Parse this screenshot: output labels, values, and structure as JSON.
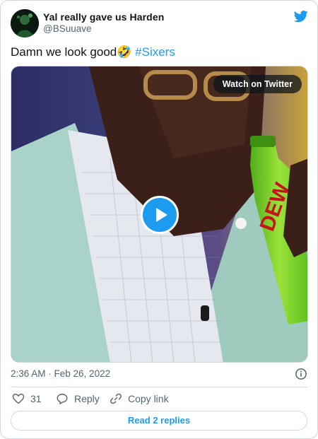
{
  "author": {
    "display_name": "Yal really gave us Harden",
    "handle": "@BSuuave",
    "avatar_icon": "avatar-image"
  },
  "tweet": {
    "text": "Damn we look good🤣",
    "hashtag": "#Sixers",
    "timestamp": "2:36 AM · Feb 26, 2022"
  },
  "media": {
    "watch_label": "Watch on Twitter",
    "play_icon": "play-icon"
  },
  "actions": {
    "like_count": "31",
    "reply_label": "Reply",
    "copy_link_label": "Copy link"
  },
  "footer": {
    "read_replies_label": "Read 2 replies"
  },
  "colors": {
    "accent": "#1d9bf0",
    "muted": "#536471",
    "border": "#cfd9de"
  }
}
